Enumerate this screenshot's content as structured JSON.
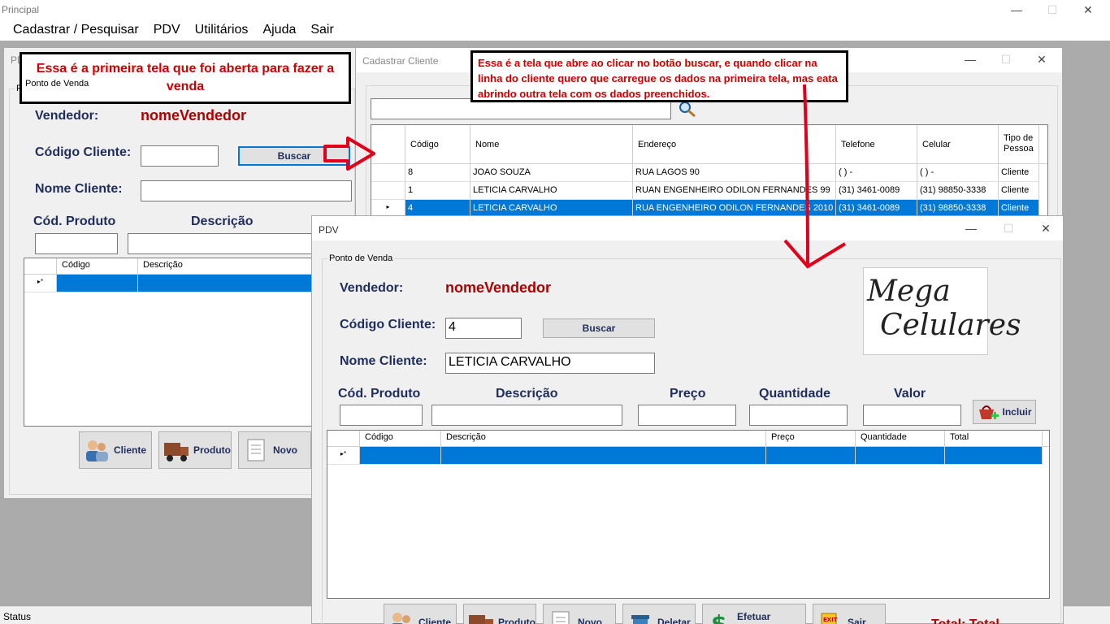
{
  "main_window": {
    "title": "Principal",
    "menu": [
      "Cadastrar / Pesquisar",
      "PDV",
      "Utilitários",
      "Ajuda",
      "Sair"
    ],
    "status": "Status"
  },
  "pdv_first": {
    "title": "PD",
    "group_title": "Ponto de Venda",
    "vendedor_label": "Vendedor:",
    "vendedor_value": "nomeVendedor",
    "codigo_cliente_label": "Código Cliente:",
    "codigo_cliente_value": "",
    "buscar_label": "Buscar",
    "nome_cliente_label": "Nome Cliente:",
    "nome_cliente_value": "",
    "cod_produto_label": "Cód. Produto",
    "descricao_label": "Descrição",
    "grid_headers": [
      "Código",
      "Descrição"
    ],
    "row_marker": "▸*",
    "buttons": {
      "cliente": "Cliente",
      "produto": "Produto",
      "novo": "Novo"
    }
  },
  "cadastrar_cliente": {
    "title": "Cadastrar Cliente",
    "search_value": "",
    "search_icon": "magnifier-icon",
    "headers": [
      "",
      "Código",
      "Nome",
      "Endereço",
      "Telefone",
      "Celular",
      "Tipo de Pessoa"
    ],
    "rows": [
      {
        "marker": "",
        "codigo": "8",
        "nome": "JOAO SOUZA",
        "endereco": "RUA LAGOS 90",
        "telefone": "( )    -",
        "celular": "( )     -",
        "tipo": "Cliente"
      },
      {
        "marker": "",
        "codigo": "1",
        "nome": "LETICIA CARVALHO",
        "endereco": "RUAN ENGENHEIRO ODILON FERNANDES 99",
        "telefone": "(31) 3461-0089",
        "celular": "(31) 98850-3338",
        "tipo": "Cliente"
      },
      {
        "marker": "▸",
        "codigo": "4",
        "nome": "LETICIA CARVALHO",
        "endereco": "RUA ENGENHEIRO ODILON FERNANDES 2010",
        "telefone": "(31) 3461-0089",
        "celular": "(31) 98850-3338",
        "tipo": "Cliente"
      }
    ]
  },
  "pdv_second": {
    "title": "PDV",
    "group_title": "Ponto de Venda",
    "vendedor_label": "Vendedor:",
    "vendedor_value": "nomeVendedor",
    "codigo_cliente_label": "Código Cliente:",
    "codigo_cliente_value": "4",
    "buscar_label": "Buscar",
    "nome_cliente_label": "Nome Cliente:",
    "nome_cliente_value": "LETICIA CARVALHO",
    "logo_line1": "Mega",
    "logo_line2": "Celulares",
    "cod_produto_label": "Cód. Produto",
    "descricao_label": "Descrição",
    "preco_label": "Preço",
    "quantidade_label": "Quantidade",
    "valor_label": "Valor",
    "incluir_label": "Incluir",
    "grid_headers": [
      "Código",
      "Descrição",
      "Preço",
      "Quantidade",
      "Total"
    ],
    "row_marker": "▸*",
    "buttons": {
      "cliente": "Cliente",
      "produto": "Produto",
      "novo": "Novo",
      "deletar": "Deletar",
      "efetuar_venda": "Efetuar Venda",
      "sair": "Sair"
    },
    "total_fragment": "Total: Total"
  },
  "annotations": {
    "first": "Essa é a primeira tela que foi aberta para fazer a venda",
    "second": "Essa é a tela que abre ao clicar no botão buscar, e quando clicar na linha do cliente quero que carregue os dados na primeira tela, mas eata abrindo outra tela com os dados preenchidos.",
    "arrow_color": "#e0001a"
  },
  "colors": {
    "accent": "#0078d7",
    "label": "#1f2d5c",
    "vendor": "#b00000",
    "annotation": "#d00000"
  }
}
